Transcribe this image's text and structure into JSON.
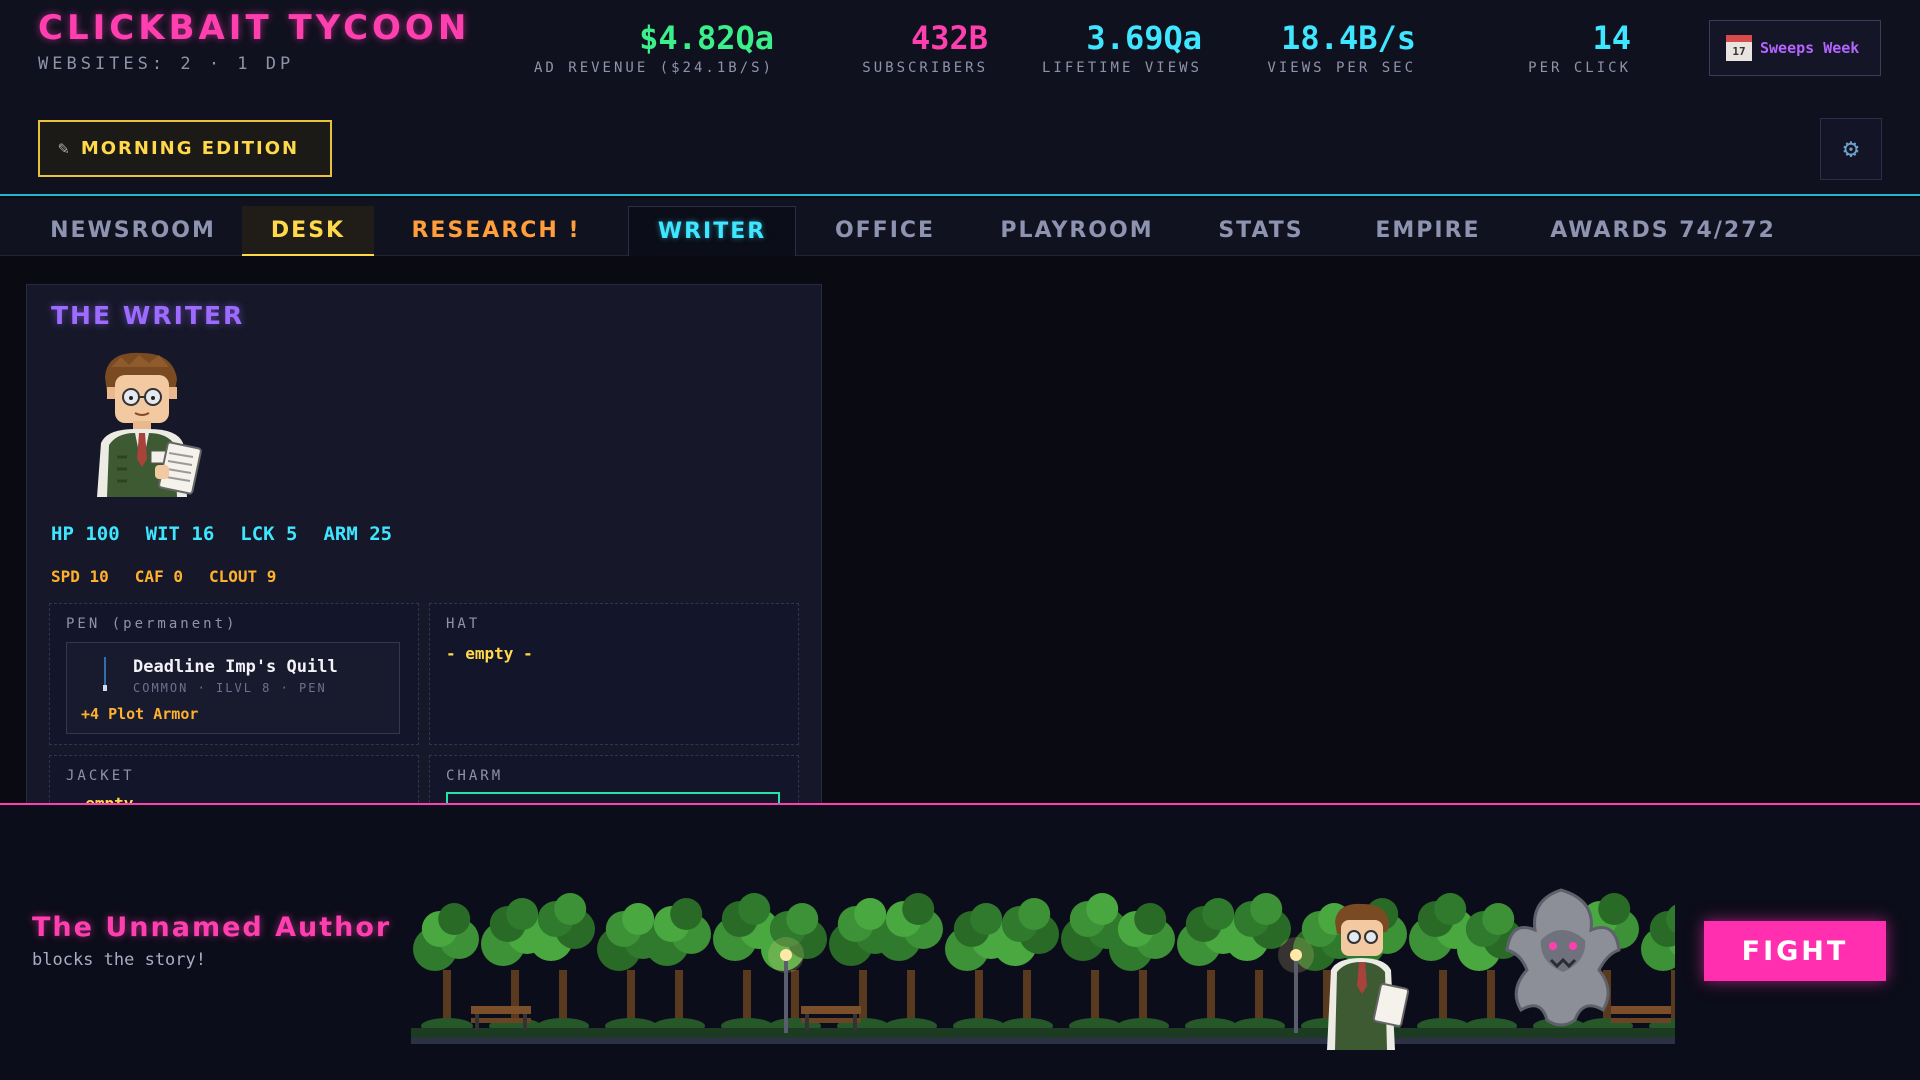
{
  "header": {
    "title": "CLICKBAIT TYCOON",
    "subtitle": "WEBSITES: 2 · 1 DP",
    "stats": [
      {
        "value": "$4.82Qa",
        "label": "AD REVENUE ($24.1B/S)",
        "color": "#3bf08a"
      },
      {
        "value": "432B",
        "label": "SUBSCRIBERS",
        "color": "#ff3fb0"
      },
      {
        "value": "3.69Qa",
        "label": "LIFETIME VIEWS",
        "color": "#3ee6ff"
      },
      {
        "value": "18.4B/s",
        "label": "VIEWS PER SEC",
        "color": "#3ee6ff"
      },
      {
        "value": "14",
        "label": "PER CLICK",
        "color": "#3ee6ff"
      }
    ],
    "event": {
      "label": "Sweeps Week",
      "icon": "calendar-icon",
      "day": "17"
    },
    "edition": {
      "label": "MORNING EDITION",
      "icon": "pencil-icon"
    },
    "settings_icon": "gear-icon"
  },
  "tabs": [
    {
      "label": "NEWSROOM"
    },
    {
      "label": "DESK"
    },
    {
      "label": "RESEARCH !"
    },
    {
      "label": "WRITER"
    },
    {
      "label": "OFFICE"
    },
    {
      "label": "PLAYROOM"
    },
    {
      "label": "STATS"
    },
    {
      "label": "EMPIRE"
    },
    {
      "label": "AWARDS 74/272"
    }
  ],
  "writer": {
    "title": "THE WRITER",
    "stats_primary": [
      "HP 100",
      "WIT 16",
      "LCK 5",
      "ARM 25"
    ],
    "stats_secondary": [
      "SPD 10",
      "CAF 0",
      "CLOUT 9"
    ],
    "slots": {
      "pen": {
        "label": "PEN (permanent)",
        "item_name": "Deadline Imp's Quill",
        "item_meta": "COMMON · ILVL 8 · PEN",
        "item_bonus": "+4 Plot Armor"
      },
      "hat": {
        "label": "HAT",
        "value": "- empty -"
      },
      "jacket": {
        "label": "JACKET",
        "value": "- empty -"
      },
      "charm": {
        "label": "CHARM"
      }
    }
  },
  "battle": {
    "enemy_name": "The Unnamed Author",
    "enemy_sub": "blocks the story!",
    "fight_label": "FIGHT"
  },
  "colors": {
    "accent_pink": "#ff3fb0",
    "accent_cyan": "#3ee6ff",
    "accent_yellow": "#ffd94a",
    "accent_purple": "#9d6bff",
    "accent_green": "#3bf08a"
  }
}
